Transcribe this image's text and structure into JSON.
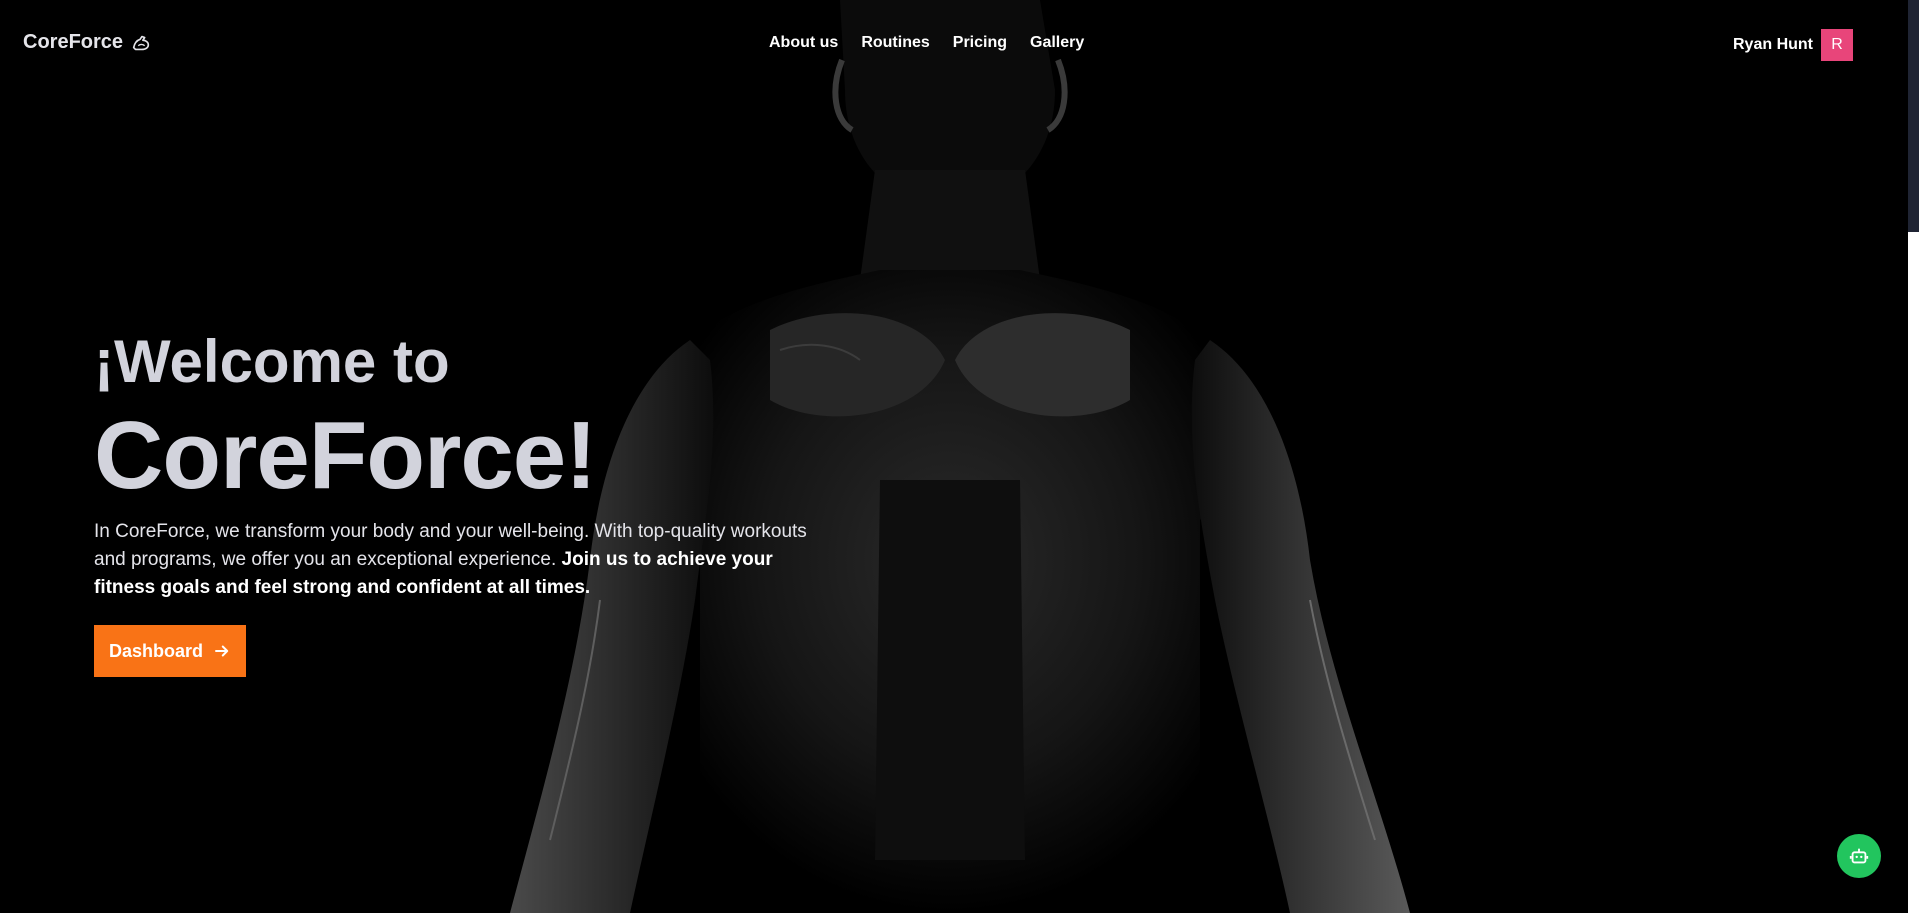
{
  "header": {
    "logo_text": "CoreForce",
    "logo_icon": "flexed-arm-icon",
    "nav": [
      {
        "label": "About us"
      },
      {
        "label": "Routines"
      },
      {
        "label": "Pricing"
      },
      {
        "label": "Gallery"
      }
    ],
    "user": {
      "name": "Ryan Hunt",
      "avatar_initial": "R",
      "avatar_color": "#e8457a"
    }
  },
  "hero": {
    "welcome_line": "¡Welcome to",
    "brand_line": "CoreForce!",
    "description": "In CoreForce, we transform your body and your well-being. With top-quality workouts and programs, we offer you an exceptional experience.",
    "description_bold": "Join us to achieve your fitness goals and feel strong and confident at all times.",
    "cta_label": "Dashboard",
    "cta_icon": "arrow-right-icon",
    "cta_color": "#f97316"
  },
  "chat_bot": {
    "icon": "robot-icon",
    "color": "#22c55e"
  }
}
